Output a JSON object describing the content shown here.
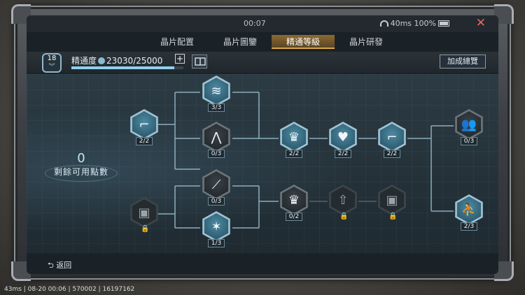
{
  "status": {
    "time": "00:07",
    "ping": "40ms",
    "battery": "100%"
  },
  "tabs": [
    {
      "label": "晶片配置",
      "active": false
    },
    {
      "label": "晶片圖鑒",
      "active": false
    },
    {
      "label": "精通等級",
      "active": true
    },
    {
      "label": "晶片研發",
      "active": false
    }
  ],
  "rank": {
    "level": "18"
  },
  "mastery": {
    "label": "精通度",
    "value": "23030/25000",
    "progress_fraction": 0.921
  },
  "bonus_button": "加成總覽",
  "points": {
    "value": "0",
    "label": "剩餘可用點數"
  },
  "nodes": {
    "left_pistol": "2/2",
    "left_backpack": "",
    "col2_flame": "3/3",
    "col2_grass": "0/3",
    "col2_knife": "0/3",
    "col2_burst": "1/3",
    "upper_crown": "2/2",
    "upper_heart": "2/2",
    "upper_gun": "2/2",
    "lower_crown": "0/2",
    "right_team": "0/3",
    "right_kneel": "2/3"
  },
  "back": {
    "label": "返回"
  },
  "bottom_info": "43ms | 08-20 00:06 | 570002 | 16197162",
  "colors": {
    "accent": "#d9a648",
    "line": "#9fc3d3"
  }
}
